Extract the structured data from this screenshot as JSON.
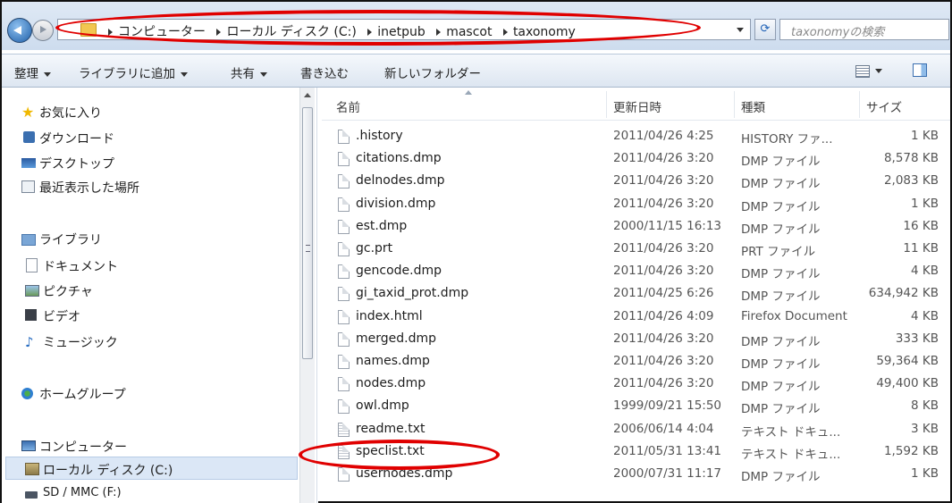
{
  "address_bar": {
    "breadcrumbs": [
      "コンピューター",
      "ローカル ディスク (C:)",
      "inetpub",
      "mascot",
      "taxonomy"
    ],
    "search_placeholder": "taxonomyの検索"
  },
  "toolbar": {
    "organize": "整理",
    "add_to_library": "ライブラリに追加",
    "share": "共有",
    "burn": "書き込む",
    "new_folder": "新しいフォルダー"
  },
  "nav": {
    "favorites": "お気に入り",
    "downloads": "ダウンロード",
    "desktop": "デスクトップ",
    "recent": "最近表示した場所",
    "libraries": "ライブラリ",
    "documents": "ドキュメント",
    "pictures": "ピクチャ",
    "videos": "ビデオ",
    "music": "ミュージック",
    "homegroup": "ホームグループ",
    "computer": "コンピューター",
    "local_disk": "ローカル ディスク (C:)",
    "sd_card": "SD / MMC (F:)"
  },
  "columns": {
    "name": "名前",
    "date": "更新日時",
    "type": "種類",
    "size": "サイズ"
  },
  "files": [
    {
      "name": ".history",
      "date": "2011/04/26 4:25",
      "type": "HISTORY ファ...",
      "size": "1 KB",
      "icon": "file-icon"
    },
    {
      "name": "citations.dmp",
      "date": "2011/04/26 3:20",
      "type": "DMP ファイル",
      "size": "8,578 KB",
      "icon": "file-icon"
    },
    {
      "name": "delnodes.dmp",
      "date": "2011/04/26 3:20",
      "type": "DMP ファイル",
      "size": "2,083 KB",
      "icon": "file-icon"
    },
    {
      "name": "division.dmp",
      "date": "2011/04/26 3:20",
      "type": "DMP ファイル",
      "size": "1 KB",
      "icon": "file-icon"
    },
    {
      "name": "est.dmp",
      "date": "2000/11/15 16:13",
      "type": "DMP ファイル",
      "size": "16 KB",
      "icon": "file-icon"
    },
    {
      "name": "gc.prt",
      "date": "2011/04/26 3:20",
      "type": "PRT ファイル",
      "size": "11 KB",
      "icon": "file-icon"
    },
    {
      "name": "gencode.dmp",
      "date": "2011/04/26 3:20",
      "type": "DMP ファイル",
      "size": "4 KB",
      "icon": "file-icon"
    },
    {
      "name": "gi_taxid_prot.dmp",
      "date": "2011/04/25 6:26",
      "type": "DMP ファイル",
      "size": "634,942 KB",
      "icon": "file-icon"
    },
    {
      "name": "index.html",
      "date": "2011/04/26 4:09",
      "type": "Firefox Document",
      "size": "4 KB",
      "icon": "file-icon"
    },
    {
      "name": "merged.dmp",
      "date": "2011/04/26 3:20",
      "type": "DMP ファイル",
      "size": "333 KB",
      "icon": "file-icon"
    },
    {
      "name": "names.dmp",
      "date": "2011/04/26 3:20",
      "type": "DMP ファイル",
      "size": "59,364 KB",
      "icon": "file-icon"
    },
    {
      "name": "nodes.dmp",
      "date": "2011/04/26 3:20",
      "type": "DMP ファイル",
      "size": "49,400 KB",
      "icon": "file-icon"
    },
    {
      "name": "owl.dmp",
      "date": "1999/09/21 15:50",
      "type": "DMP ファイル",
      "size": "8 KB",
      "icon": "file-icon"
    },
    {
      "name": "readme.txt",
      "date": "2006/06/14 4:04",
      "type": "テキスト ドキュ...",
      "size": "3 KB",
      "icon": "text-file-icon"
    },
    {
      "name": "speclist.txt",
      "date": "2011/05/31 13:41",
      "type": "テキスト ドキュ...",
      "size": "1,592 KB",
      "icon": "text-file-icon"
    },
    {
      "name": "usernodes.dmp",
      "date": "2000/07/31 11:17",
      "type": "DMP ファイル",
      "size": "1 KB",
      "icon": "file-icon"
    }
  ],
  "annotation_color": "#e00000"
}
